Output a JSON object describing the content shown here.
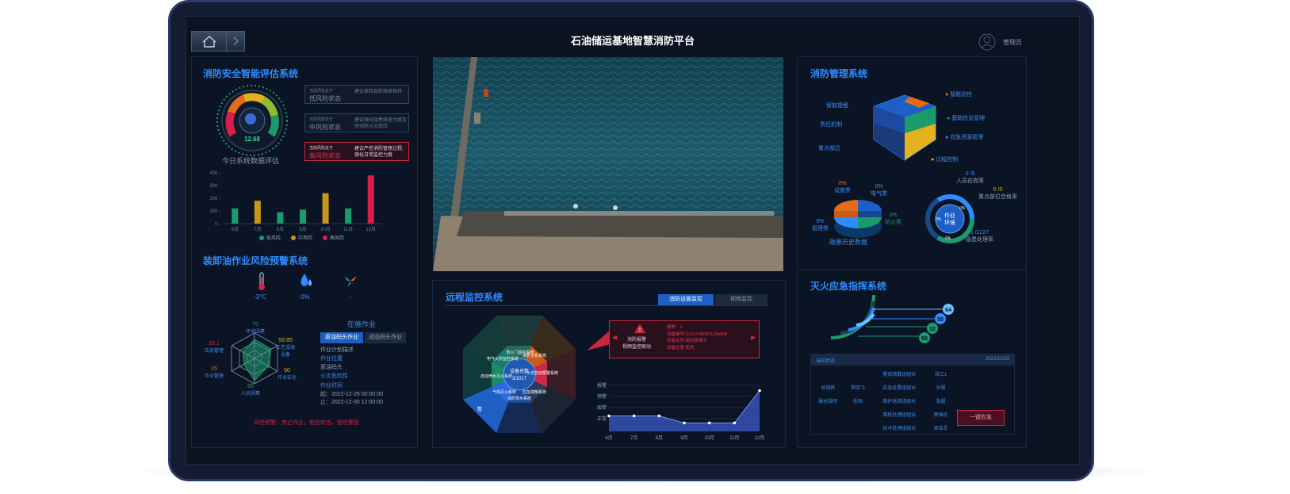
{
  "app": {
    "title": "石油储运基地智慧消防平台",
    "user": "管理员"
  },
  "assessment": {
    "title": "消防安全智能评估系统",
    "gauge_value": "12.68",
    "gauge_ticks": [
      "10",
      "20",
      "30",
      "40",
      "50",
      "60",
      "70",
      "80",
      "90"
    ],
    "caption": "今日系统数据评估",
    "statuses": [
      {
        "label": "当前风险处于",
        "value": "低风险状态",
        "advice": "建议保持现状继续保持",
        "level": "low"
      },
      {
        "label": "当前风险处于",
        "value": "中风险状态",
        "advice": "建议强化隐患排查力度及时消除火灾风险",
        "level": "mid"
      },
      {
        "label": "当前风险处于",
        "value": "高风险状态",
        "advice": "建议严控消防管理过程,强化日常监控力度",
        "level": "high"
      }
    ]
  },
  "chart_data": {
    "type": "bar",
    "categories": [
      "6月",
      "7月",
      "8月",
      "9月",
      "10月",
      "11月",
      "12月"
    ],
    "values": [
      120,
      180,
      90,
      110,
      240,
      120,
      380
    ],
    "risk_levels": [
      "low",
      "mid",
      "low",
      "low",
      "mid",
      "low",
      "high"
    ],
    "ylim": [
      0,
      400
    ],
    "yticks": [
      "400",
      "300",
      "200",
      "100",
      "0"
    ],
    "legend": [
      "低风险",
      "中风险",
      "高风险"
    ],
    "colors": {
      "low": "#1a9b6c",
      "mid": "#c9961c",
      "high": "#d81e4a"
    }
  },
  "loading": {
    "title": "装卸油作业风险预警系统",
    "temperature": "-3℃",
    "humidity": "0%",
    "wind": "-",
    "radar_labels": [
      {
        "value": "75",
        "name": "环境因素"
      },
      {
        "value": "59.85",
        "name": "工艺设施设备"
      },
      {
        "value": "50",
        "name": "作业安全"
      },
      {
        "value": "90",
        "name": "人员因素"
      },
      {
        "value": "25",
        "name": "作业管理"
      },
      {
        "value": "28.1",
        "name": "应急管理"
      }
    ],
    "ops_title": "在施作业",
    "ops_tabs": [
      "原油码头作业",
      "成品码头作业"
    ],
    "ops_plan": "作业计划描述",
    "ops_location_label": "作业位置",
    "ops_location": "原油码头",
    "ops_fire_label": "火灾危险性",
    "ops_time_label": "作业时间",
    "ops_start": "起：2022-12-26 00:00:00",
    "ops_end": "止：2022-12-30 12:00:00",
    "warning": "风险预警：禁止作业，危险状态，危险警告"
  },
  "monitor": {
    "title": "远程监控系统",
    "tabs": [
      "消防设施监控",
      "视频监控"
    ],
    "octagon_center": [
      "设备总数",
      "3/1017"
    ],
    "octagon_segments": [
      "消防主机系统",
      "火灾自动报警系统",
      "应急疏散系统",
      "消防供水系统",
      "气体灭火系统",
      "自动喷水灭火系统",
      "电气火灾监控系统",
      "防火门监控系统"
    ],
    "corner_label": "整",
    "alarm_title": "消防报警",
    "alarm_sub": "视频监控联动",
    "alarm_lines": [
      "报警：1",
      "设备编号:GSXJ-05050123el8f8",
      "设备名称:南向摄像头",
      "设备位置:机房"
    ],
    "line_y_labels": [
      "报警",
      "预警",
      "故障",
      "正常"
    ],
    "line_x_labels": [
      "6月",
      "7月",
      "8月",
      "9月",
      "10月",
      "11月",
      "12月"
    ],
    "line_values": [
      1.1,
      1.1,
      1.1,
      0.6,
      0.6,
      0.6,
      2.9
    ],
    "line_ylim": [
      0,
      3.5
    ]
  },
  "management": {
    "title": "消防管理系统",
    "cube_labels_left": [
      "智能提醒",
      "责任机制",
      "重点部位"
    ],
    "cube_labels_right": [
      "智能巡检",
      "基础信息管理",
      "应急资源管理",
      "过程控制"
    ],
    "hazard_title": "隐患历史数据",
    "hazard_labels": [
      {
        "pct": "0%",
        "name": "设施类"
      },
      {
        "pct": "0%",
        "name": "电气类"
      },
      {
        "pct": "0%",
        "name": "管理类"
      },
      {
        "pct": "0%",
        "name": "防火类"
      }
    ],
    "work_center": [
      "作业",
      "环境"
    ],
    "work_labels": [
      {
        "value": "0 /5",
        "name": "人员在岗率"
      },
      {
        "value": "0 /0",
        "name": "重点部位合格率"
      },
      {
        "value": "1 /1227",
        "name": "隐患处理率"
      }
    ],
    "work_pcts": [
      "0%",
      "0%",
      "0%"
    ]
  },
  "command": {
    "title": "灭火应急指挥系统",
    "rings": [
      "64",
      "58",
      "32",
      "68"
    ],
    "table_header_left": "当前状态",
    "table_header_date": "2022/12/29",
    "cells": [
      [
        "",
        "",
        "",
        "警戒疏散组组长",
        "张三1",
        ""
      ],
      [
        "总指挥",
        "李四飞",
        "",
        "应急处置组组长",
        "孙恩",
        ""
      ],
      [
        "副总指挥",
        "张刚",
        "",
        "救护急救组组长",
        "张超",
        ""
      ],
      [
        "",
        "",
        "",
        "事故处理组组长",
        "郭振乐",
        ""
      ],
      [
        "",
        "",
        "",
        "技术处理组组长",
        "周会军",
        ""
      ]
    ],
    "one_key_button": "一键应急"
  }
}
